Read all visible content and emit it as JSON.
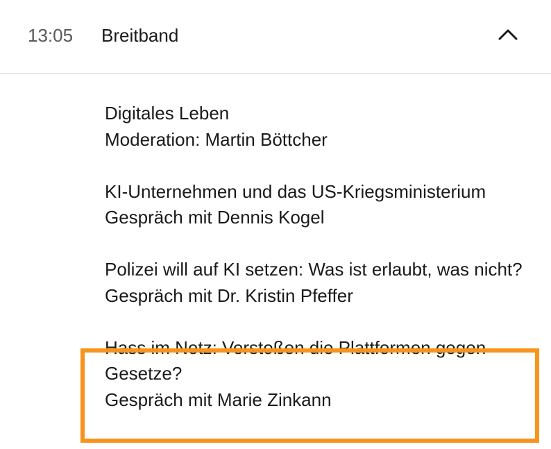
{
  "header": {
    "time": "13:05",
    "title": "Breitband",
    "toggle_icon": "chevron-up-icon"
  },
  "items": [
    {
      "title": "Digitales Leben",
      "subtitle": "Moderation: Martin Böttcher"
    },
    {
      "title": "KI-Unternehmen und das US-Kriegsministerium",
      "subtitle": "Gespräch mit Dennis Kogel"
    },
    {
      "title": "Polizei will auf KI setzen: Was ist erlaubt, was nicht?",
      "subtitle": "Gespräch mit Dr. Kristin Pfeffer"
    },
    {
      "title": "Hass im Netz: Verstoßen die Plattformen gegen Gesetze?",
      "subtitle": "Gespräch mit Marie Zinkann",
      "highlighted": true
    }
  ],
  "colors": {
    "highlight": "#f7941d",
    "divider": "#e6e6e6",
    "time_text": "#595959"
  }
}
